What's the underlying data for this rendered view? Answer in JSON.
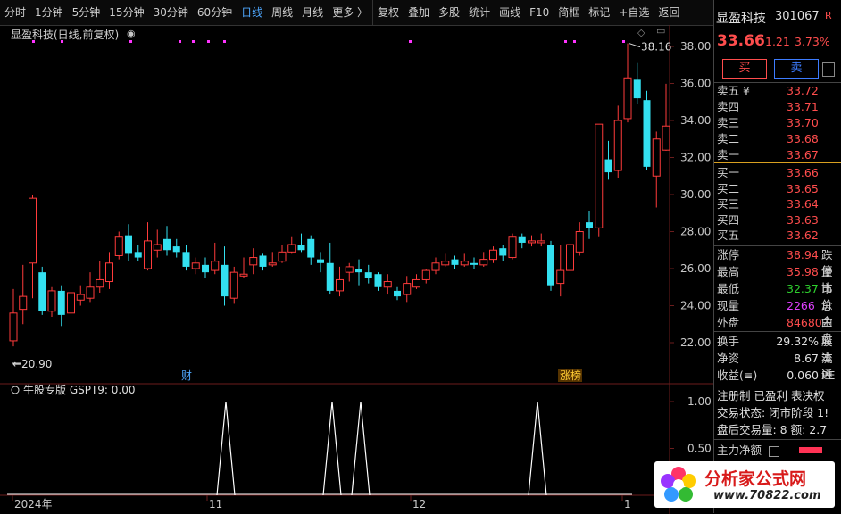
{
  "toolbar": {
    "items": [
      "分时",
      "1分钟",
      "5分钟",
      "15分钟",
      "30分钟",
      "60分钟",
      "日线",
      "周线",
      "月线",
      "更多 〉",
      "复权",
      "叠加",
      "多股",
      "统计",
      "画线",
      "F10",
      "简框",
      "标记",
      "+自选",
      "返回"
    ],
    "active_index": 6
  },
  "chart": {
    "title": "显盈科技(日线,前复权)",
    "high_label": "38.16",
    "low_label": "20.90",
    "price_ticks": [
      "38.00",
      "36.00",
      "34.00",
      "32.00",
      "30.00",
      "28.00",
      "26.00",
      "24.00",
      "22.00"
    ],
    "event_cai": "财",
    "event_zhangbang": "涨榜"
  },
  "indicator": {
    "title": "牛股专版  GSPT9: 0.00",
    "ticks": [
      "1.00",
      "0.50"
    ]
  },
  "xaxis": {
    "labels": [
      "2024年",
      "11",
      "12",
      "1"
    ]
  },
  "quote": {
    "name": "显盈科技",
    "code": "301067",
    "flag": "R",
    "price": "33.66",
    "change": "1.21",
    "pct": "3.73%",
    "buy_btn": "买",
    "sell_btn": "卖",
    "sell_levels": [
      {
        "label": "卖五 ¥",
        "price": "33.72"
      },
      {
        "label": "卖四",
        "price": "33.71"
      },
      {
        "label": "卖三",
        "price": "33.70"
      },
      {
        "label": "卖二",
        "price": "33.68"
      },
      {
        "label": "卖一",
        "price": "33.67"
      }
    ],
    "buy_levels": [
      {
        "label": "买一",
        "price": "33.66"
      },
      {
        "label": "买二",
        "price": "33.65"
      },
      {
        "label": "买三",
        "price": "33.64"
      },
      {
        "label": "买四",
        "price": "33.63"
      },
      {
        "label": "买五",
        "price": "33.62"
      }
    ],
    "stats": [
      {
        "label": "涨停",
        "value": "38.94",
        "color": "red",
        "extra": "跌停"
      },
      {
        "label": "最高",
        "value": "35.98",
        "color": "red",
        "extra": "量比"
      },
      {
        "label": "最低",
        "value": "32.37",
        "color": "green",
        "extra": "市价"
      },
      {
        "label": "现量",
        "value": "2266",
        "color": "magenta",
        "extra": "总金"
      },
      {
        "label": "外盘",
        "value": "84680",
        "color": "red",
        "extra": "内盘"
      }
    ],
    "stats2": [
      {
        "label": "换手",
        "value": "29.32%",
        "extra": "股本"
      },
      {
        "label": "净资",
        "value": "8.67",
        "extra": "流通"
      },
      {
        "label": "收益(≡)",
        "value": "0.060",
        "extra": "PE"
      }
    ],
    "notes": [
      "注册制 已盈利 表决权",
      "交易状态: 闭市阶段 1!",
      "盘后交易量: 8  额: 2.7"
    ],
    "main_net": "主力净额"
  },
  "logo": {
    "text": "分析家公式网",
    "url": "www.70822.com"
  },
  "chart_data": {
    "type": "candlestick",
    "price_range": [
      21,
      39
    ],
    "candles": [
      [
        22.1,
        23.6,
        24.9,
        21.8
      ],
      [
        23.8,
        24.5,
        26.2,
        23.0
      ],
      [
        26.3,
        29.8,
        30.0,
        24.4
      ],
      [
        25.8,
        23.7,
        26.1,
        23.5
      ],
      [
        23.7,
        24.8,
        25.0,
        23.4
      ],
      [
        24.8,
        23.5,
        25.1,
        22.9
      ],
      [
        23.6,
        24.7,
        25.0,
        23.5
      ],
      [
        24.3,
        24.6,
        25.1,
        24.0
      ],
      [
        24.4,
        25.0,
        25.8,
        24.2
      ],
      [
        25.0,
        25.4,
        26.4,
        24.7
      ],
      [
        25.3,
        26.3,
        26.9,
        24.9
      ],
      [
        26.7,
        27.7,
        28.0,
        26.5
      ],
      [
        27.8,
        26.8,
        28.4,
        26.4
      ],
      [
        26.9,
        26.6,
        27.3,
        26.4
      ],
      [
        26.0,
        27.5,
        28.5,
        25.9
      ],
      [
        27.0,
        27.3,
        28.1,
        26.6
      ],
      [
        27.6,
        27.0,
        28.3,
        26.7
      ],
      [
        27.2,
        26.9,
        27.6,
        26.6
      ],
      [
        26.9,
        26.1,
        27.3,
        25.9
      ],
      [
        26.0,
        26.3,
        26.6,
        25.7
      ],
      [
        26.2,
        25.8,
        26.6,
        25.5
      ],
      [
        25.9,
        26.4,
        27.4,
        25.7
      ],
      [
        26.2,
        24.5,
        27.2,
        24.0
      ],
      [
        24.4,
        25.8,
        26.1,
        24.1
      ],
      [
        25.6,
        25.7,
        26.6,
        25.5
      ],
      [
        26.2,
        26.6,
        27.1,
        25.7
      ],
      [
        26.7,
        26.1,
        26.8,
        25.9
      ],
      [
        26.2,
        26.3,
        26.9,
        26.1
      ],
      [
        26.4,
        26.9,
        27.3,
        26.3
      ],
      [
        26.9,
        27.3,
        27.7,
        26.8
      ],
      [
        27.3,
        27.0,
        27.9,
        26.9
      ],
      [
        27.6,
        26.6,
        27.8,
        26.2
      ],
      [
        26.5,
        26.3,
        26.9,
        25.8
      ],
      [
        26.3,
        24.8,
        27.4,
        24.6
      ],
      [
        24.8,
        25.4,
        26.1,
        24.5
      ],
      [
        25.8,
        26.1,
        26.3,
        25.3
      ],
      [
        26.0,
        25.8,
        26.5,
        25.1
      ],
      [
        25.8,
        25.5,
        26.2,
        25.2
      ],
      [
        25.7,
        25.0,
        25.8,
        24.8
      ],
      [
        25.0,
        25.3,
        25.7,
        24.6
      ],
      [
        24.8,
        24.5,
        25.0,
        24.3
      ],
      [
        24.6,
        25.2,
        25.6,
        24.2
      ],
      [
        25.0,
        25.4,
        25.7,
        24.9
      ],
      [
        25.4,
        25.9,
        26.0,
        25.2
      ],
      [
        25.9,
        26.3,
        26.6,
        25.7
      ],
      [
        26.2,
        26.4,
        26.8,
        26.1
      ],
      [
        26.5,
        26.2,
        26.7,
        26.0
      ],
      [
        26.2,
        26.4,
        26.8,
        26.1
      ],
      [
        26.3,
        26.2,
        26.6,
        26.0
      ],
      [
        26.2,
        26.5,
        26.9,
        26.1
      ],
      [
        26.5,
        27.0,
        27.2,
        26.3
      ],
      [
        27.1,
        26.7,
        27.3,
        26.4
      ],
      [
        26.6,
        27.7,
        27.9,
        26.5
      ],
      [
        27.7,
        27.4,
        27.9,
        27.1
      ],
      [
        27.4,
        27.5,
        27.8,
        27.2
      ],
      [
        27.4,
        27.5,
        27.9,
        27.2
      ],
      [
        27.3,
        25.1,
        27.5,
        24.8
      ],
      [
        25.2,
        25.9,
        27.3,
        24.5
      ],
      [
        25.9,
        27.3,
        27.8,
        25.7
      ],
      [
        26.9,
        28.0,
        28.5,
        26.7
      ],
      [
        28.5,
        28.2,
        29.1,
        27.6
      ],
      [
        28.2,
        33.8,
        33.8,
        27.7
      ],
      [
        31.9,
        31.2,
        32.9,
        30.8
      ],
      [
        31.3,
        34.0,
        34.8,
        30.9
      ],
      [
        34.1,
        36.3,
        38.16,
        33.9
      ],
      [
        36.2,
        35.2,
        37.1,
        34.9
      ],
      [
        35.1,
        31.5,
        35.6,
        31.3
      ],
      [
        31.0,
        33.0,
        33.4,
        29.3
      ],
      [
        32.4,
        33.7,
        35.98,
        32.37
      ]
    ],
    "indicator": {
      "name": "GSPT9",
      "value": 0.0,
      "ylim": [
        0,
        1.2
      ],
      "spike_indices": [
        24,
        35,
        38,
        58
      ],
      "spike_value": 1.0
    }
  }
}
